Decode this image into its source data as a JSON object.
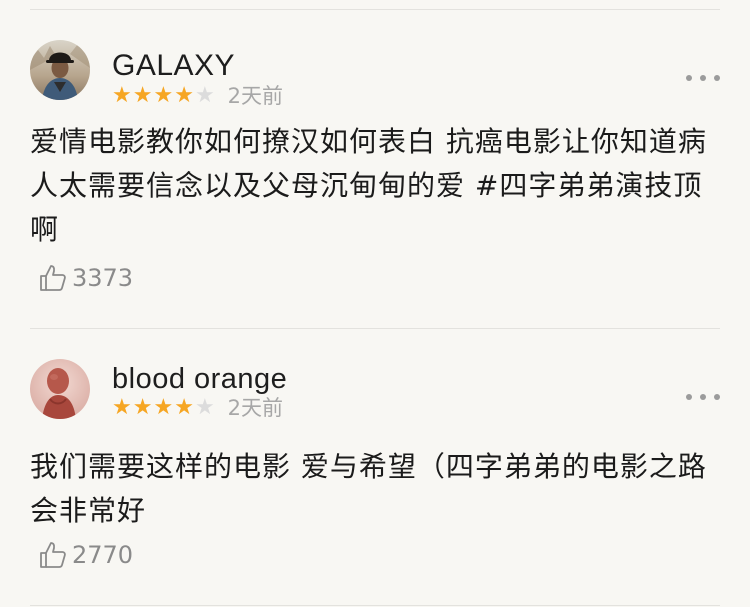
{
  "comments": [
    {
      "username": "GALAXY",
      "rating": 4,
      "max_rating": 5,
      "time": "2天前",
      "content": "爱情电影教你如何撩汉如何表白 抗癌电影让你知道病人太需要信念以及父母沉甸甸的爱 #四字弟弟演技顶啊",
      "likes": "3373",
      "avatar_desc": "avatar-photo-galaxy"
    },
    {
      "username": "blood orange",
      "rating": 4,
      "max_rating": 5,
      "time": "2天前",
      "content": "我们需要这样的电影 爱与希望（四字弟弟的电影之路会非常好",
      "likes": "2770",
      "avatar_desc": "avatar-photo-blood-orange"
    }
  ],
  "icons": {
    "star": "star-icon",
    "more": "more-dots-icon",
    "like": "thumbs-up-icon"
  },
  "colors": {
    "background": "#f8f7f3",
    "star_filled": "#f6a623",
    "star_empty": "#dcdcdc",
    "divider": "#e3e2de",
    "meta_text": "#a7a7a7",
    "like_text": "#8a8a8a"
  }
}
